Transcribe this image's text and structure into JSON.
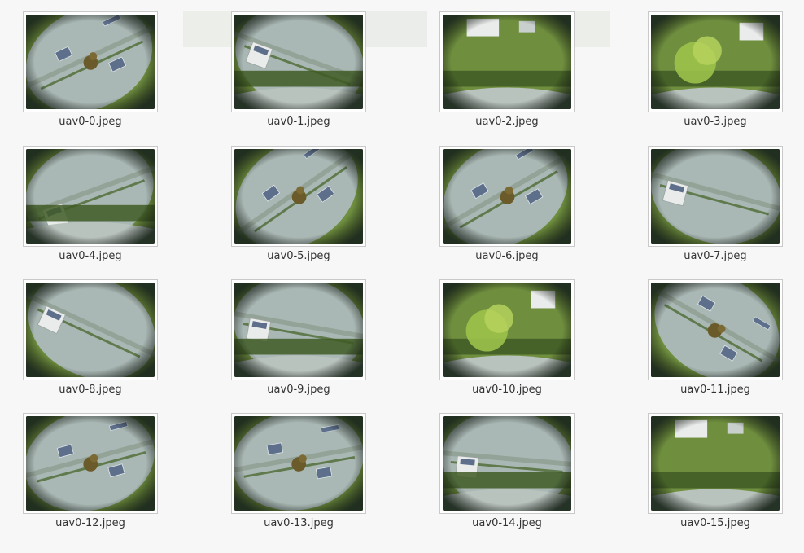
{
  "files": [
    {
      "name": "uav0-0.jpeg",
      "scene": "roof-solar"
    },
    {
      "name": "uav0-1.jpeg",
      "scene": "roof-lawn"
    },
    {
      "name": "uav0-2.jpeg",
      "scene": "lawn-path"
    },
    {
      "name": "uav0-3.jpeg",
      "scene": "tree-lawn"
    },
    {
      "name": "uav0-4.jpeg",
      "scene": "roof-lawn"
    },
    {
      "name": "uav0-5.jpeg",
      "scene": "roof-diag"
    },
    {
      "name": "uav0-6.jpeg",
      "scene": "roof-diag"
    },
    {
      "name": "uav0-7.jpeg",
      "scene": "roof-house"
    },
    {
      "name": "uav0-8.jpeg",
      "scene": "roof-house"
    },
    {
      "name": "uav0-9.jpeg",
      "scene": "roof-lawn"
    },
    {
      "name": "uav0-10.jpeg",
      "scene": "tree-lawn"
    },
    {
      "name": "uav0-11.jpeg",
      "scene": "roof-solar"
    },
    {
      "name": "uav0-12.jpeg",
      "scene": "roof-solar"
    },
    {
      "name": "uav0-13.jpeg",
      "scene": "roof-solar"
    },
    {
      "name": "uav0-14.jpeg",
      "scene": "roof-lawn"
    },
    {
      "name": "uav0-15.jpeg",
      "scene": "lawn-path"
    }
  ],
  "colors": {
    "background": "#f7f7f7",
    "label": "#333333",
    "roof": "#a9b8b4",
    "grass": "#6f8f3f",
    "shrub": "#3f5a25",
    "dark_edge": "#1d2a1e",
    "solar": "#5e6f8c",
    "building": "#e9ecea",
    "sky_glare": "#d9e6e4"
  }
}
